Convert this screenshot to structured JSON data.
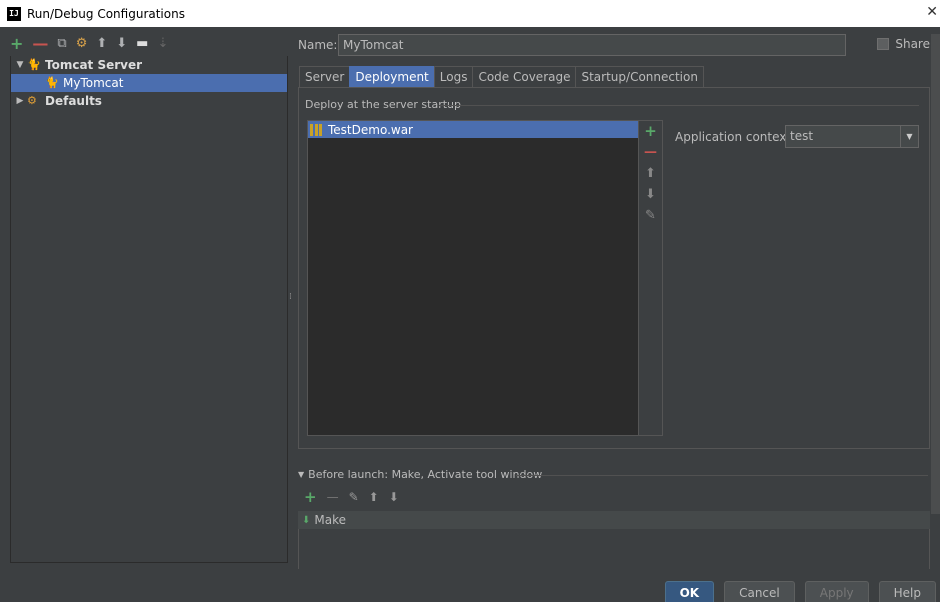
{
  "window": {
    "title": "Run/Debug Configurations",
    "app_icon_text": "IJ",
    "close_glyph": "✕"
  },
  "left_toolbar": [
    {
      "name": "add-icon",
      "glyph": "+"
    },
    {
      "name": "remove-icon",
      "glyph": "—"
    },
    {
      "name": "copy-icon",
      "glyph": "⧉"
    },
    {
      "name": "settings-icon",
      "glyph": "⚙"
    },
    {
      "name": "move-up-icon",
      "glyph": "⬆"
    },
    {
      "name": "move-down-icon",
      "glyph": "⬇"
    },
    {
      "name": "folder-icon",
      "glyph": "▬"
    },
    {
      "name": "sort-icon",
      "glyph": "⇣"
    }
  ],
  "tree": {
    "tomcat_server": "Tomcat Server",
    "my_tomcat": "MyTomcat",
    "defaults": "Defaults"
  },
  "name_field": {
    "label": "Name:",
    "value": "MyTomcat"
  },
  "share": {
    "label": "Share"
  },
  "tabs": [
    "Server",
    "Deployment",
    "Logs",
    "Code Coverage",
    "Startup/Connection"
  ],
  "deployment": {
    "section_title": "Deploy at the server startup",
    "items": [
      "TestDemo.war"
    ],
    "side_tools": [
      "+",
      "—",
      "⬆",
      "⬇",
      "✎"
    ],
    "app_context_label": "Application context:",
    "app_context_value": "test"
  },
  "before_launch": {
    "title": "Before launch: Make, Activate tool window",
    "tools": [
      "+",
      "—",
      "✎",
      "⬆",
      "⬇"
    ],
    "items": [
      "Make"
    ]
  },
  "buttons": {
    "ok": "OK",
    "cancel": "Cancel",
    "apply": "Apply",
    "help": "Help"
  }
}
